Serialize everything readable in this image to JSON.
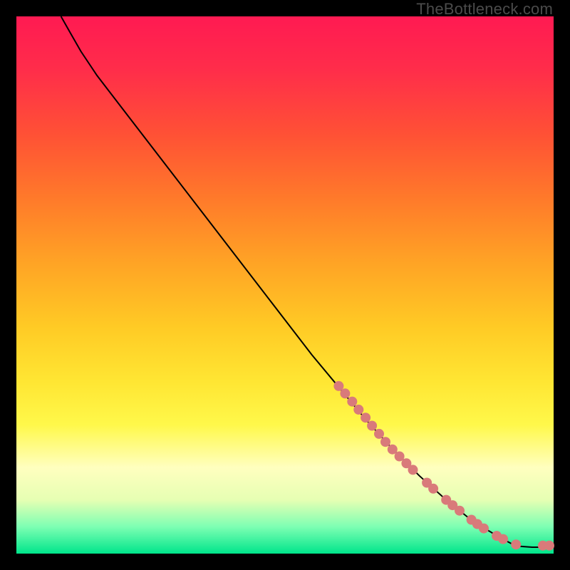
{
  "watermark": "TheBottleneck.com",
  "colors": {
    "curve": "#000000",
    "marker_fill": "#d97a7a",
    "marker_stroke": "#c96a6a"
  },
  "chart_data": {
    "type": "line",
    "title": "",
    "xlabel": "",
    "ylabel": "",
    "xlim": [
      0,
      100
    ],
    "ylim": [
      0,
      100
    ],
    "note": "Axes are unlabeled in the image; x/y are normalized percent of plot area. Curve descends from top-left to bottom-right; bottom (low y) is green, top (high y) is red.",
    "curve": [
      {
        "x": 8.3,
        "y": 100.0
      },
      {
        "x": 10.0,
        "y": 97.0
      },
      {
        "x": 12.0,
        "y": 93.5
      },
      {
        "x": 15.0,
        "y": 89.0
      },
      {
        "x": 20.0,
        "y": 82.5
      },
      {
        "x": 25.0,
        "y": 76.0
      },
      {
        "x": 30.0,
        "y": 69.5
      },
      {
        "x": 35.0,
        "y": 63.0
      },
      {
        "x": 40.0,
        "y": 56.5
      },
      {
        "x": 45.0,
        "y": 50.0
      },
      {
        "x": 50.0,
        "y": 43.5
      },
      {
        "x": 55.0,
        "y": 37.0
      },
      {
        "x": 60.0,
        "y": 31.0
      },
      {
        "x": 65.0,
        "y": 25.0
      },
      {
        "x": 70.0,
        "y": 19.5
      },
      {
        "x": 75.0,
        "y": 14.5
      },
      {
        "x": 80.0,
        "y": 10.0
      },
      {
        "x": 85.0,
        "y": 6.0
      },
      {
        "x": 90.0,
        "y": 3.0
      },
      {
        "x": 93.0,
        "y": 1.4
      },
      {
        "x": 96.0,
        "y": 1.2
      },
      {
        "x": 98.0,
        "y": 1.2
      },
      {
        "x": 99.2,
        "y": 1.2
      }
    ],
    "markers": [
      {
        "x": 60.0,
        "y": 31.2
      },
      {
        "x": 61.2,
        "y": 29.8
      },
      {
        "x": 62.5,
        "y": 28.3
      },
      {
        "x": 63.7,
        "y": 26.8
      },
      {
        "x": 65.0,
        "y": 25.3
      },
      {
        "x": 66.2,
        "y": 23.8
      },
      {
        "x": 67.5,
        "y": 22.3
      },
      {
        "x": 68.7,
        "y": 20.8
      },
      {
        "x": 70.0,
        "y": 19.4
      },
      {
        "x": 71.3,
        "y": 18.1
      },
      {
        "x": 72.6,
        "y": 16.8
      },
      {
        "x": 73.8,
        "y": 15.6
      },
      {
        "x": 76.4,
        "y": 13.2
      },
      {
        "x": 77.6,
        "y": 12.1
      },
      {
        "x": 80.0,
        "y": 10.0
      },
      {
        "x": 81.2,
        "y": 9.0
      },
      {
        "x": 82.5,
        "y": 8.0
      },
      {
        "x": 84.7,
        "y": 6.3
      },
      {
        "x": 85.8,
        "y": 5.5
      },
      {
        "x": 87.0,
        "y": 4.7
      },
      {
        "x": 89.4,
        "y": 3.3
      },
      {
        "x": 90.6,
        "y": 2.7
      },
      {
        "x": 93.0,
        "y": 1.7
      },
      {
        "x": 98.0,
        "y": 1.5
      },
      {
        "x": 99.2,
        "y": 1.5
      }
    ],
    "marker_radius_px": 7
  }
}
